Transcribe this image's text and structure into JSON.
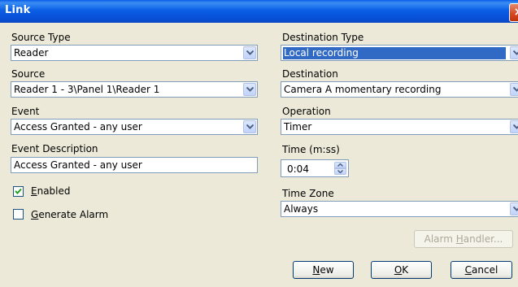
{
  "window": {
    "title": "Link",
    "close_label": "×"
  },
  "left": {
    "source_type": {
      "label": "Source Type",
      "value": "Reader"
    },
    "source": {
      "label": "Source",
      "value": "Reader 1 - 3\\Panel 1\\Reader 1"
    },
    "event": {
      "label": "Event",
      "value": "Access Granted - any user"
    },
    "event_description": {
      "label": "Event Description",
      "value": "Access Granted - any user"
    },
    "enabled": {
      "label_u": "E",
      "label_rest": "nabled",
      "checked": true
    },
    "generate_alarm": {
      "label_u": "G",
      "label_rest": "enerate Alarm",
      "checked": false
    }
  },
  "right": {
    "destination_type": {
      "label": "Destination Type",
      "value": "Local recording"
    },
    "destination": {
      "label": "Destination",
      "value": "Camera A momentary recording"
    },
    "operation": {
      "label": "Operation",
      "value": "Timer"
    },
    "time": {
      "label": "Time (m:ss)",
      "value": "0:04"
    },
    "time_zone": {
      "label": "Time Zone",
      "value": "Always"
    },
    "alarm_handler": {
      "label_pre": "Alarm ",
      "label_u": "H",
      "label_post": "andler..."
    }
  },
  "buttons": {
    "new": {
      "label_u": "N",
      "label_rest": "ew"
    },
    "ok": {
      "label_u": "O",
      "label_rest": "K"
    },
    "cancel": {
      "label_u": "C",
      "label_rest": "ancel"
    }
  }
}
